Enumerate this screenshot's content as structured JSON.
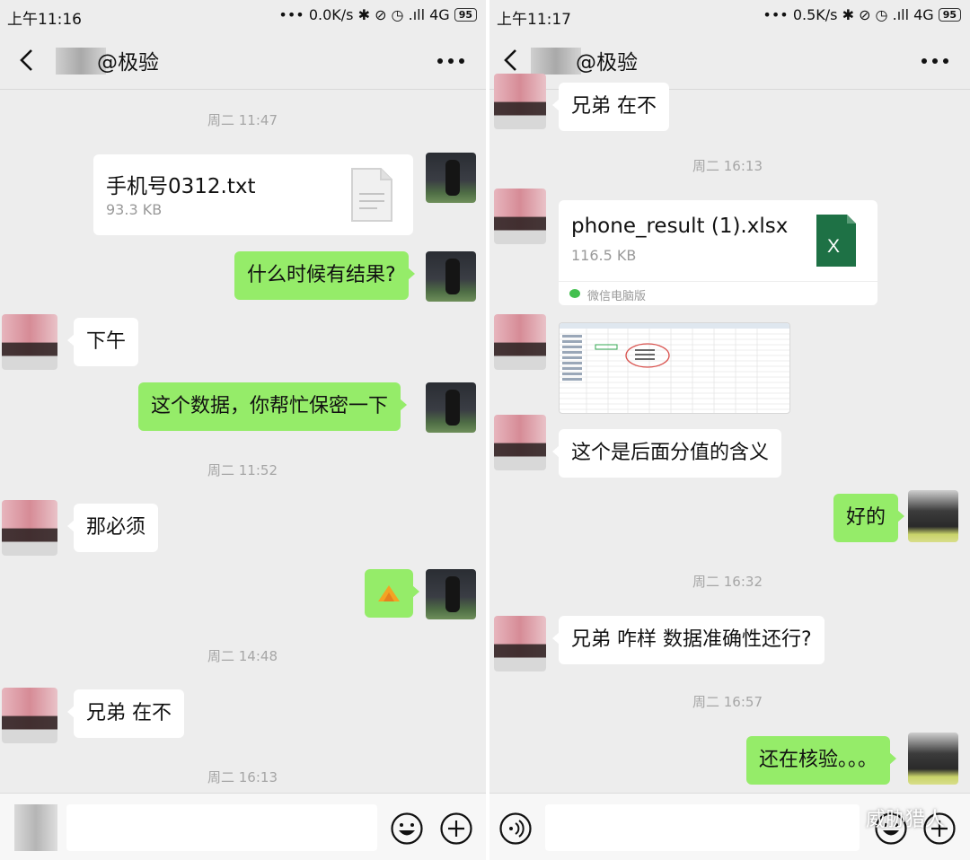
{
  "left": {
    "status": {
      "time": "上午11:16",
      "net": "••• 0.0K/s ✱ ⊘ ◷ .ıll 4G",
      "battery": "95"
    },
    "header": {
      "title": "@极验"
    },
    "messages": {
      "t1": "周二 11:47",
      "file": {
        "name": "手机号0312.txt",
        "size": "93.3 KB"
      },
      "m1": "什么时候有结果?",
      "m2": "下午",
      "m3": "这个数据，你帮忙保密一下",
      "t2": "周二 11:52",
      "m4": "那必须",
      "t3": "周二 14:48",
      "m5": "兄弟  在不",
      "t4": "周二 16:13"
    }
  },
  "right": {
    "status": {
      "time": "上午11:17",
      "net": "••• 0.5K/s ✱ ⊘ ◷ .ıll 4G",
      "battery": "95"
    },
    "header": {
      "title": "@极验"
    },
    "messages": {
      "m0": "兄弟  在不",
      "t1": "周二 16:13",
      "file": {
        "name": "phone_result (1).xlsx",
        "size": "116.5 KB",
        "source": "微信电脑版",
        "icon_letter": "X"
      },
      "m1": "这个是后面分值的含义",
      "m2": "好的",
      "t2": "周二 16:32",
      "m3": "兄弟  咋样  数据准确性还行?",
      "t3": "周二 16:57",
      "m4": "还在核验。。。"
    },
    "watermark": "威胁猎人"
  },
  "colors": {
    "chat_bg": "#ededed",
    "self_bubble": "#95ec69",
    "peer_bubble": "#ffffff",
    "excel_green": "#1e7145"
  }
}
